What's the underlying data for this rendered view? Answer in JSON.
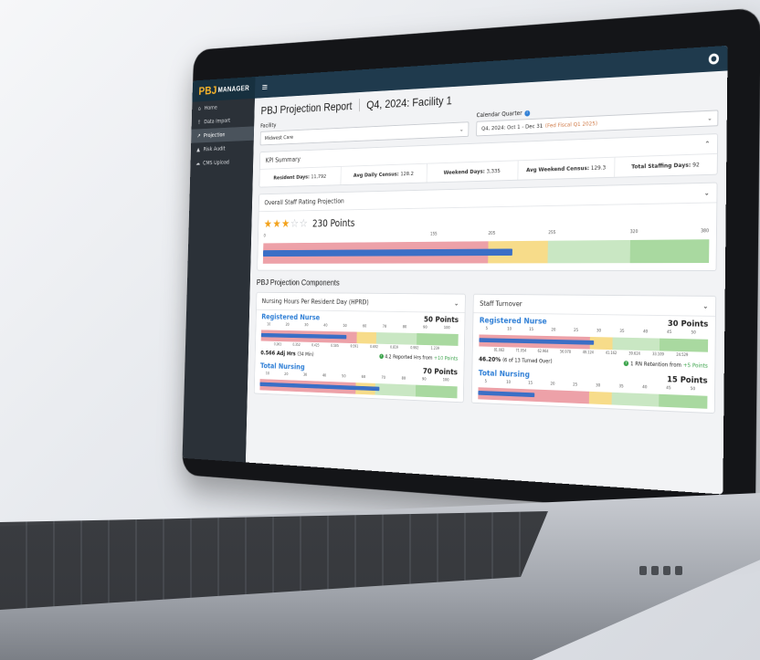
{
  "app": {
    "logo_main": "PBJ",
    "logo_sub": "MANAGER"
  },
  "sidebar": {
    "items": [
      {
        "label": "Home",
        "icon": "home-icon"
      },
      {
        "label": "Data Import",
        "icon": "upload-icon"
      },
      {
        "label": "Projection",
        "icon": "chart-line-icon"
      },
      {
        "label": "Risk Audit",
        "icon": "warning-icon"
      },
      {
        "label": "CMS Upload",
        "icon": "cloud-upload-icon"
      }
    ]
  },
  "header": {
    "title": "PBJ Projection Report",
    "subtitle": "Q4, 2024: Facility 1"
  },
  "filters": {
    "facility_label": "Facility",
    "facility_value": "Midwest Care",
    "quarter_label": "Calendar Quarter",
    "quarter_value": "Q4, 2024: Oct 1 - Dec 31",
    "quarter_note": "(Fed Fiscal Q1 2025)"
  },
  "kpi": {
    "title": "KPI Summary",
    "items": [
      {
        "label": "Resident Days:",
        "value": "11,792"
      },
      {
        "label": "Avg Daily Census:",
        "value": "128.2"
      },
      {
        "label": "Weekend Days:",
        "value": "3,335"
      },
      {
        "label": "Avg Weekend Census:",
        "value": "129.3"
      },
      {
        "label": "Total Staffing Days:",
        "value": "92"
      }
    ]
  },
  "overall": {
    "title": "Overall Staff Rating Projection",
    "stars": 3,
    "stars_max": 5,
    "points_label": "230 Points",
    "scale": [
      "0",
      "155",
      "205",
      "255",
      "320",
      "380"
    ],
    "points_value": 230,
    "scale_max": 380
  },
  "components": {
    "title": "PBJ Projection Components",
    "hprd": {
      "title": "Nursing Hours Per Resident Day (HPRD)",
      "rn": {
        "name": "Registered Nurse",
        "points": "50 Points",
        "ticks": [
          "10",
          "20",
          "30",
          "40",
          "50",
          "60",
          "70",
          "80",
          "90",
          "100"
        ],
        "values": [
          "0.261",
          "0.352",
          "0.425",
          "0.505",
          "0.591",
          "0.692",
          "0.819",
          "0.992",
          "1.239"
        ],
        "adj": "0.566 Adj Hrs",
        "adj_sub": "(34 Min)",
        "note": "4.2 Reported Hrs from",
        "note_plus": "+10 Points",
        "fill": 0.45
      },
      "total": {
        "name": "Total Nursing",
        "points": "70 Points",
        "ticks": [
          "10",
          "20",
          "30",
          "40",
          "50",
          "60",
          "70",
          "80",
          "90",
          "100"
        ],
        "fill": 0.62
      }
    },
    "turnover": {
      "title": "Staff Turnover",
      "rn": {
        "name": "Registered Nurse",
        "points": "30 Points",
        "ticks": [
          "5",
          "10",
          "15",
          "20",
          "25",
          "30",
          "35",
          "40",
          "45",
          "50"
        ],
        "values": [
          "81.082",
          "71.054",
          "62.964",
          "56.978",
          "49.124",
          "41.162",
          "39.624",
          "33.109",
          "24.529"
        ],
        "adj": "46.20%",
        "adj_sub": "(6 of 13 Turned Over)",
        "note": "1 RN Retention from",
        "note_plus": "+5 Points",
        "fill": 0.52
      },
      "total": {
        "name": "Total Nursing",
        "points": "15 Points",
        "ticks": [
          "5",
          "10",
          "15",
          "20",
          "25",
          "30",
          "35",
          "40",
          "45",
          "50"
        ],
        "fill": 0.26
      }
    }
  },
  "colors": {
    "pink": "#eda1a8",
    "yellow": "#f7dc8a",
    "green": "#a9d9a0",
    "lightgreen": "#c9e7c3",
    "blue": "#3b6fc6",
    "accent": "#2f7fd6"
  }
}
